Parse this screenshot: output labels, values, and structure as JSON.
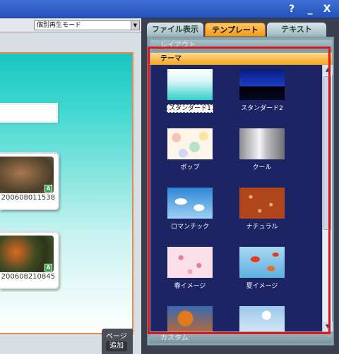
{
  "window": {
    "help_label": "?",
    "minimize_label": "_",
    "close_label": "X"
  },
  "left": {
    "mode_select": "個別再生モード",
    "photos": [
      {
        "label": "200608011538",
        "badge": "A"
      },
      {
        "label": "200608210845",
        "badge": "A"
      }
    ],
    "page_label": "ページ",
    "add_label": "追加"
  },
  "tabs": [
    {
      "label": "ファイル表示",
      "active": false
    },
    {
      "label": "テンプレート",
      "active": true
    },
    {
      "label": "テキスト",
      "active": false
    }
  ],
  "panel": {
    "layout_header": "レイアウト",
    "theme_header": "テーマ",
    "custom_header": "カスタム",
    "themes": [
      {
        "label": "スタンダード1",
        "selected": true
      },
      {
        "label": "スタンダード2"
      },
      {
        "label": "ポップ"
      },
      {
        "label": "クール"
      },
      {
        "label": "ロマンチック"
      },
      {
        "label": "ナチュラル"
      },
      {
        "label": "春イメージ"
      },
      {
        "label": "夏イメージ"
      },
      {
        "label": ""
      },
      {
        "label": ""
      }
    ]
  },
  "colors": {
    "accent_orange": "#f4a51e",
    "highlight_red": "#e0161e",
    "theme_bg": "#1d2463"
  }
}
